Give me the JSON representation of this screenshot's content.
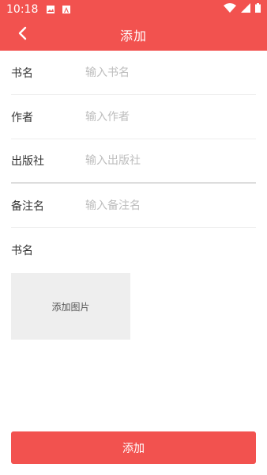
{
  "status_bar": {
    "time": "10:18",
    "icons": [
      "image-icon",
      "a-icon",
      "wifi-icon",
      "signal-icon",
      "battery-icon"
    ]
  },
  "app_bar": {
    "title": "添加",
    "back_icon": "chevron-left-icon"
  },
  "form": {
    "fields": [
      {
        "label": "书名",
        "placeholder": "输入书名",
        "value": ""
      },
      {
        "label": "作者",
        "placeholder": "输入作者",
        "value": ""
      },
      {
        "label": "出版社",
        "placeholder": "输入出版社",
        "value": ""
      },
      {
        "label": "备注名",
        "placeholder": "输入备注名",
        "value": ""
      }
    ],
    "image_label": "书名",
    "image_picker_text": "添加图片"
  },
  "submit_label": "添加",
  "colors": {
    "accent": "#f2524f",
    "picker_bg": "#eeeeee",
    "placeholder": "#bdbdbd"
  }
}
